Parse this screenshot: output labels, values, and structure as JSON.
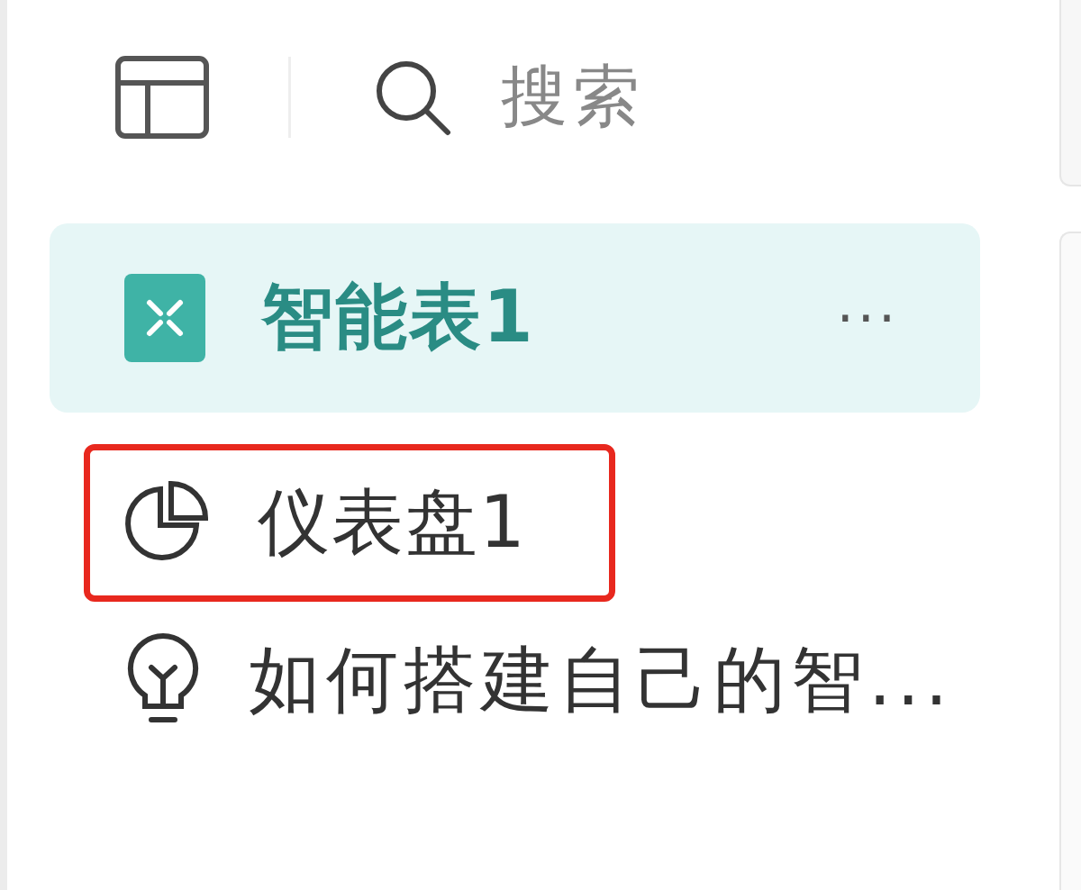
{
  "search": {
    "placeholder": "搜索"
  },
  "items": [
    {
      "kind": "table",
      "label": "智能表1",
      "selected": true,
      "highlighted": false,
      "more": "···"
    },
    {
      "kind": "dashboard",
      "label": "仪表盘1",
      "selected": false,
      "highlighted": true
    },
    {
      "kind": "guide",
      "label": "如何搭建自己的智...",
      "selected": false,
      "highlighted": false
    }
  ]
}
